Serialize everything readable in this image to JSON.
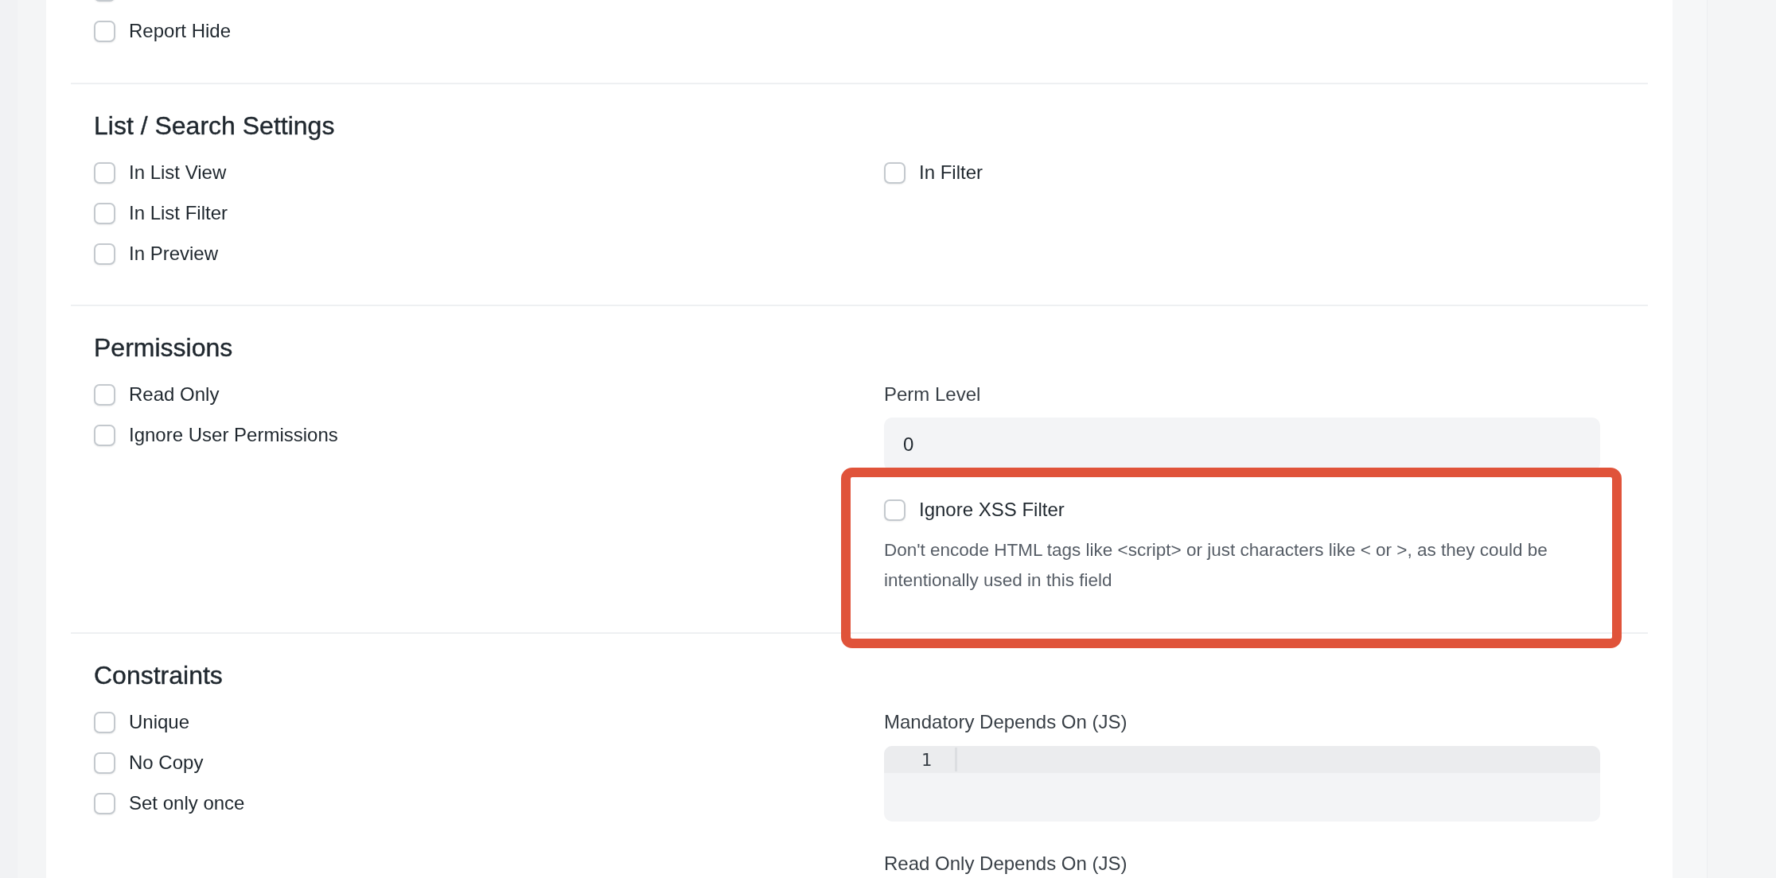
{
  "sections": [
    {
      "left": [
        {
          "checked": false
        },
        {
          "label": "Report Hide",
          "checked": false
        }
      ]
    },
    {
      "title": "List / Search Settings",
      "left": [
        {
          "label": "In List View",
          "checked": false
        },
        {
          "label": "In List Filter",
          "checked": false
        },
        {
          "label": "In Preview",
          "checked": false
        }
      ],
      "right": [
        {
          "kind": "checkbox",
          "label": "In Filter",
          "checked": false,
          "highlighted": false
        }
      ]
    },
    {
      "title": "Permissions",
      "left": [
        {
          "label": "Read Only",
          "checked": false
        },
        {
          "label": "Ignore User Permissions",
          "checked": false
        }
      ],
      "right": [
        {
          "kind": "input",
          "label": "Perm Level",
          "value": "0"
        },
        {
          "kind": "checkbox",
          "label": "Ignore XSS Filter",
          "checked": false,
          "highlighted": true,
          "description": "Don't encode HTML tags like <script> or just characters like < or >, as they could be intentionally used in this field"
        }
      ]
    },
    {
      "title": "Constraints",
      "left": [
        {
          "label": "Unique",
          "checked": false
        },
        {
          "label": "No Copy",
          "checked": false
        },
        {
          "label": "Set only once",
          "checked": false
        }
      ],
      "right": [
        {
          "kind": "code",
          "label": "Mandatory Depends On (JS)",
          "line_numbers": [
            "1"
          ]
        },
        {
          "kind": "label",
          "label": "Read Only Depends On (JS)"
        }
      ]
    }
  ]
}
